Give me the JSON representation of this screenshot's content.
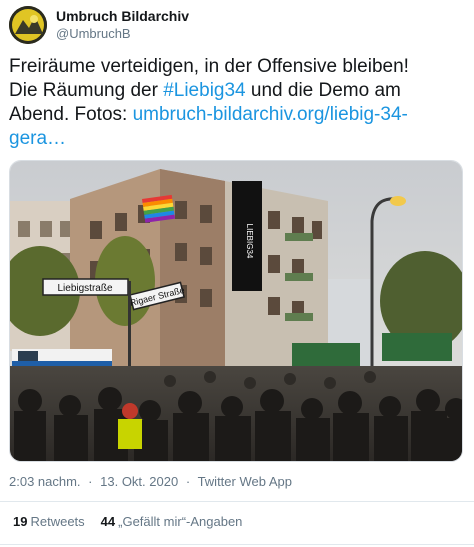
{
  "user": {
    "display_name": "Umbruch Bildarchiv",
    "handle": "@UmbruchB"
  },
  "tweet": {
    "line1": "Freiräume verteidigen, in der Offensive bleiben!",
    "line2_pre": "Die Räumung der ",
    "hashtag": "#Liebig34",
    "line2_post": " und die Demo am",
    "line3_pre": "Abend. Fotos: ",
    "link_part1": "umbruch-bildarchiv.org/liebig-34-",
    "link_part2": "gera…"
  },
  "photo": {
    "street_sign": "Liebigstraße",
    "street_sign2": "Rigaer Straße",
    "banner_text": "LIEBIG34"
  },
  "meta": {
    "time": "2:03 nachm.",
    "sep1": "·",
    "date": "13. Okt. 2020",
    "sep2": "·",
    "source": "Twitter Web App"
  },
  "stats": {
    "retweets_count": "19",
    "retweets_label": "Retweets",
    "likes_count": "44",
    "likes_label": "„Gefällt mir“-Angaben"
  }
}
